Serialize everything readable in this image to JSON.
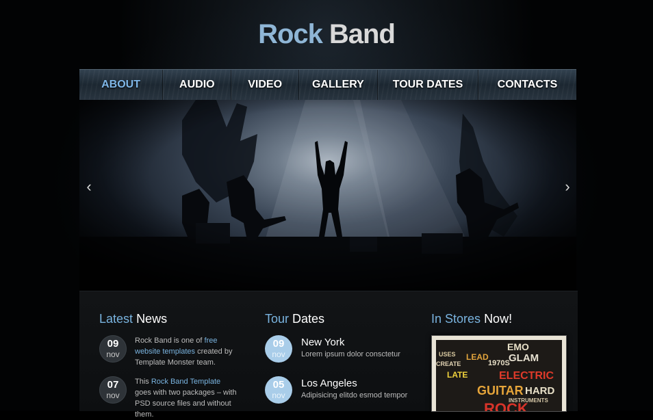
{
  "header": {
    "logo_word1": "Rock",
    "logo_word2": "Band"
  },
  "nav": {
    "items": [
      "ABOUT",
      "AUDIO",
      "VIDEO",
      "GALLERY",
      "TOUR DATES",
      "CONTACTS"
    ],
    "active": "ABOUT"
  },
  "slider": {
    "prev_icon": "chevron-left-icon",
    "next_icon": "chevron-right-icon"
  },
  "news": {
    "title_accent": "Latest",
    "title_rest": "News",
    "items": [
      {
        "day": "09",
        "month": "nov",
        "text_before": "Rock Band is one of ",
        "link": "free website templates",
        "text_after": " created by Template Monster team."
      },
      {
        "day": "07",
        "month": "nov",
        "text_before": "This ",
        "link": "Rock Band Template",
        "text_after": " goes with two packages – with PSD source files and without them."
      }
    ]
  },
  "tour": {
    "title_accent": "Tour",
    "title_rest": "Dates",
    "items": [
      {
        "day": "09",
        "month": "nov",
        "city": "New York",
        "desc": "Lorem ipsum dolor consctetur"
      },
      {
        "day": "05",
        "month": "nov",
        "city": "Los Angeles",
        "desc": "Adipisicing elitdo esmod tempor"
      }
    ]
  },
  "stores": {
    "title_accent": "In Stores",
    "title_rest": "Now!",
    "album_words": [
      "EMO",
      "USES",
      "GLAM",
      "CREATE",
      "LEAD",
      "1970S",
      "LATE",
      "ELECTRIC",
      "GUITAR",
      "HARD",
      "INSTRUMENTS",
      "ROCK"
    ]
  },
  "colors": {
    "accent": "#7ab4e0",
    "nav_active": "#7fb7e8",
    "date_blue": "#a9cde9",
    "date_dark": "#2e3338"
  }
}
